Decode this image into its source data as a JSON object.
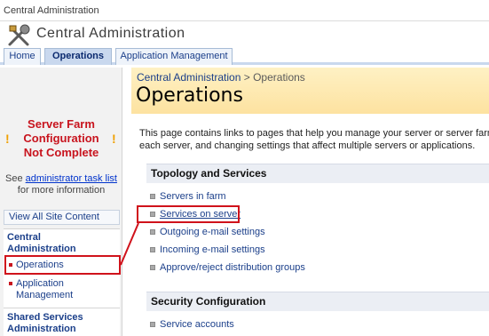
{
  "topbar": {
    "crumb": "Central Administration"
  },
  "header": {
    "title": "Central Administration",
    "logo_icon": "tools-icon"
  },
  "tabs": [
    {
      "label": "Home",
      "selected": false
    },
    {
      "label": "Operations",
      "selected": true
    },
    {
      "label": "Application Management",
      "selected": false
    }
  ],
  "leftnav": {
    "warning": {
      "line1": "Server Farm",
      "line2": "Configuration",
      "line3": "Not Complete",
      "icon": "exclamation-icon"
    },
    "see": {
      "prefix": "See",
      "link": "administrator task list",
      "suffix": "for more information"
    },
    "view_all": "View All Site Content",
    "section1": {
      "head1": "Central",
      "head2": "Administration"
    },
    "items": [
      {
        "label": "Operations"
      },
      {
        "label1": "Application",
        "label2": "Management"
      }
    ],
    "section2": {
      "head1": "Shared Services",
      "head2": "Administration"
    }
  },
  "main": {
    "breadcrumb": {
      "parent": "Central Administration",
      "sep": ">",
      "current": "Operations"
    },
    "title": "Operations",
    "description_line1": "This page contains links to pages that help you manage your server or server farm",
    "description_line2": "each server, and changing settings that affect multiple servers or applications.",
    "sections": [
      {
        "title": "Topology and Services",
        "links": [
          "Servers in farm",
          "Services on server",
          "Outgoing e-mail settings",
          "Incoming e-mail settings",
          "Approve/reject distribution groups"
        ]
      },
      {
        "title": "Security Configuration",
        "links": [
          "Service accounts"
        ]
      }
    ]
  },
  "colors": {
    "highlight": "#d0121b",
    "warning_text": "#c8141e",
    "link": "#1b3f8a",
    "header_band": "#fde2a0"
  }
}
